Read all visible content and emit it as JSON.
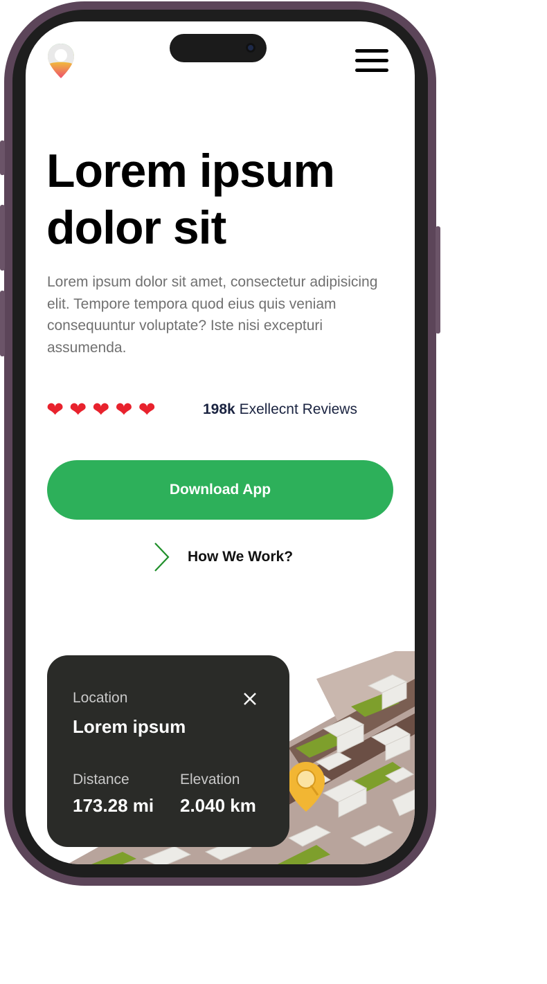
{
  "hero": {
    "title": "Lorem ipsum dolor sit",
    "description": "Lorem ipsum dolor sit amet, consectetur adipisicing elit. Tempore tempora quod eius quis veniam consequuntur voluptate? Iste nisi excepturi assumenda."
  },
  "reviews": {
    "heart_icon": "heart-icon",
    "rating": 5,
    "count": "198k",
    "label": "Exellecnt Reviews"
  },
  "actions": {
    "download_label": "Download App",
    "how_label": "How We Work?"
  },
  "location_card": {
    "location_label": "Location",
    "location_value": "Lorem ipsum",
    "distance_label": "Distance",
    "distance_value": "173.28 mi",
    "elevation_label": "Elevation",
    "elevation_value": "2.040 km"
  },
  "colors": {
    "accent": "#2db05a",
    "heart": "#e8222d",
    "card": "#2a2b28",
    "frame": "#5c4559"
  }
}
